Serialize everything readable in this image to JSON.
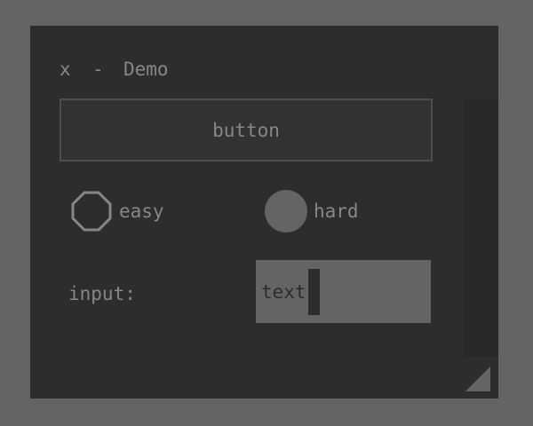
{
  "colors": {
    "desktop": "#646464",
    "window": "#2d2d2d",
    "text": "#878787",
    "button_border": "#4d4d4d",
    "input_bg": "#646464",
    "scrollbar": "#282828"
  },
  "titlebar": {
    "close_label": "x",
    "minimize_label": "-",
    "title": "Demo"
  },
  "button": {
    "label": "button"
  },
  "options": [
    {
      "label": "easy",
      "selected": false
    },
    {
      "label": "hard",
      "selected": true
    }
  ],
  "input": {
    "label": "input:",
    "value": "text"
  },
  "icons": {
    "radio_empty": "octagon-outline-icon",
    "radio_selected": "filled-circle-icon",
    "resize": "resize-grip-icon"
  }
}
